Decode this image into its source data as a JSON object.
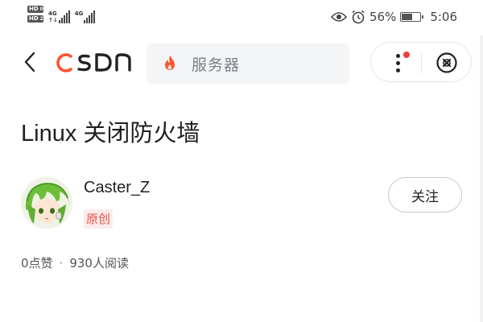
{
  "status_bar": {
    "hd_labels": [
      "HD",
      "HD"
    ],
    "hd_sub": [
      "0",
      "2"
    ],
    "network": [
      "4G",
      "4G"
    ],
    "battery_percent": "56%",
    "battery_level": 0.56,
    "time": "5:06"
  },
  "header": {
    "logo_text": "CSDN",
    "search_placeholder": "服务器",
    "brand_color": "#fc5531"
  },
  "article": {
    "title": "Linux 关闭防火墙",
    "author_name": "Caster_Z",
    "original_badge": "原创",
    "follow_label": "关注",
    "likes": "0点赞",
    "separator": "·",
    "views": "930人阅读"
  },
  "icons": {
    "back": "chevron-left-icon",
    "fire": "fire-icon",
    "more": "more-vertical-icon",
    "close": "close-circle-icon",
    "eye": "eye-icon",
    "alarm": "alarm-icon"
  }
}
